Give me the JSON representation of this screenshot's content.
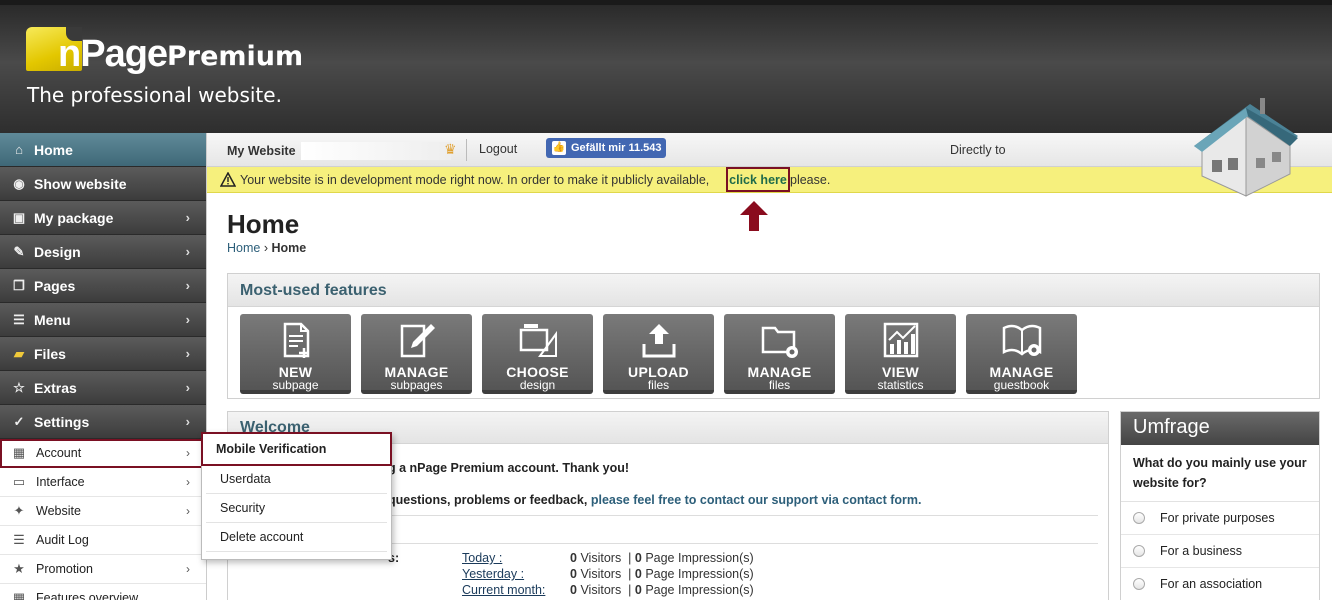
{
  "brand": {
    "logo_n": "n",
    "logo_page": "Page",
    "logo_premium": "Premium",
    "tagline": "The professional website.",
    "accent_color": "#e3c700"
  },
  "sidebar": {
    "items": [
      {
        "label": "Home",
        "icon": "home-icon",
        "active": true
      },
      {
        "label": "Show website",
        "icon": "globe-icon"
      },
      {
        "label": "My package",
        "icon": "package-icon"
      },
      {
        "label": "Design",
        "icon": "brush-icon"
      },
      {
        "label": "Pages",
        "icon": "pages-icon"
      },
      {
        "label": "Menu",
        "icon": "menu-icon"
      },
      {
        "label": "Files",
        "icon": "folder-icon"
      },
      {
        "label": "Extras",
        "icon": "star-icon"
      },
      {
        "label": "Settings",
        "icon": "wrench-icon"
      }
    ],
    "sub_items": [
      {
        "label": "Account",
        "icon": "account-icon",
        "selected": true
      },
      {
        "label": "Interface",
        "icon": "monitor-icon"
      },
      {
        "label": "Website",
        "icon": "wrench-icon"
      },
      {
        "label": "Audit Log",
        "icon": "list-icon"
      },
      {
        "label": "Promotion",
        "icon": "star-icon"
      },
      {
        "label": "Features overview",
        "icon": "grid-icon"
      }
    ]
  },
  "flyout": {
    "items": [
      "Mobile Verification",
      "Userdata",
      "Security",
      "Delete account"
    ]
  },
  "topbar": {
    "site_name": "My Website",
    "logout": "Logout",
    "fb_like": "Gefällt mir 11.543",
    "directly_to": "Directly to"
  },
  "devbar": {
    "text": "Your website is in development mode right now. In order to make it publicly available,",
    "link": "click here",
    "after": "please.",
    "color": "#f6f07d"
  },
  "page": {
    "title": "Home",
    "breadcrumb": [
      "Home",
      "Home"
    ]
  },
  "features": {
    "title": "Most-used features",
    "tiles": [
      {
        "line1": "NEW",
        "line2": "subpage",
        "icon": "new-page-icon"
      },
      {
        "line1": "MANAGE",
        "line2": "subpages",
        "icon": "edit-page-icon"
      },
      {
        "line1": "CHOOSE",
        "line2": "design",
        "icon": "design-tools-icon"
      },
      {
        "line1": "UPLOAD",
        "line2": "files",
        "icon": "upload-icon"
      },
      {
        "line1": "MANAGE",
        "line2": "files",
        "icon": "folder-gear-icon"
      },
      {
        "line1": "VIEW",
        "line2": "statistics",
        "icon": "chart-icon"
      },
      {
        "line1": "MANAGE",
        "line2": "guestbook",
        "icon": "book-gear-icon"
      }
    ]
  },
  "welcome": {
    "title": "Welcome",
    "line1": "g a nPage Premium account. Thank you!",
    "line2_pre": "questions, problems or feedback,",
    "line2_link": "please feel free to contact our support via contact form.",
    "stats_label": "s:",
    "stats": [
      {
        "period": "Today :",
        "visitors": "0",
        "visitors_label": "Visitors",
        "impressions": "0",
        "impressions_label": "Page Impression(s)"
      },
      {
        "period": "Yesterday :",
        "visitors": "0",
        "visitors_label": "Visitors",
        "impressions": "0",
        "impressions_label": "Page Impression(s)"
      },
      {
        "period": "Current month:",
        "visitors": "0",
        "visitors_label": "Visitors",
        "impressions": "0",
        "impressions_label": "Page Impression(s)"
      }
    ]
  },
  "poll": {
    "title": "Umfrage",
    "question": "What do you mainly use your website for?",
    "options": [
      "For private purposes",
      "For a business",
      "For an association"
    ]
  }
}
